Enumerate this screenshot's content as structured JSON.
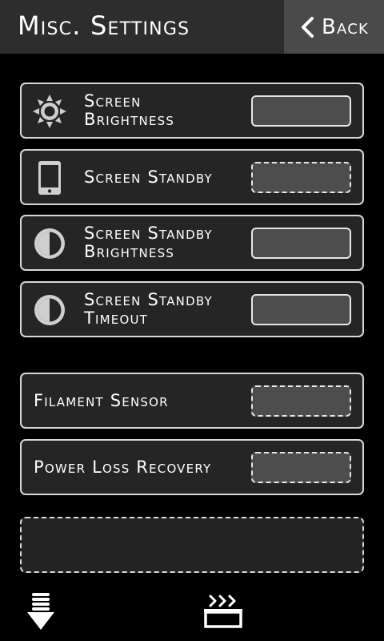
{
  "header": {
    "title": "Misc. Settings",
    "back_label": "Back"
  },
  "rows": [
    {
      "label_line1": "Screen",
      "label_line2": "Brightness",
      "icon": "sun-icon",
      "control": "solid"
    },
    {
      "label_line1": "Screen Standby",
      "label_line2": "",
      "icon": "phone-icon",
      "control": "dashed"
    },
    {
      "label_line1": "Screen Standby",
      "label_line2": "Brightness",
      "icon": "contrast-icon",
      "control": "solid"
    },
    {
      "label_line1": "Screen Standby",
      "label_line2": "Timeout",
      "icon": "contrast-icon",
      "control": "solid"
    },
    {
      "label_line1": "Filament Sensor",
      "label_line2": "",
      "icon": "",
      "control": "dashed"
    },
    {
      "label_line1": "Power Loss Recovery",
      "label_line2": "",
      "icon": "",
      "control": "dashed"
    }
  ],
  "footer": {
    "left_icon": "extrude-down-icon",
    "center_icon": "heated-bed-icon"
  },
  "colors": {
    "header_bg": "#2d2d2d",
    "back_bg": "#4a4a4a",
    "row_bg": "#252525",
    "control_bg": "#4d4d4d",
    "border": "#d8d8d8"
  }
}
